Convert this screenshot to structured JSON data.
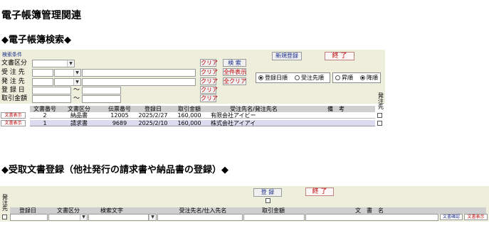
{
  "page_title": "電子帳簿管理関連",
  "search_section": {
    "heading": "◆電子帳簿検索◆",
    "conditions_label": "検索条件",
    "fields": {
      "doc_type_label": "文書区分",
      "recipient_label": "受 注 先",
      "sender_label": "発 注 先",
      "register_date_label": "登 録 日",
      "amount_label": "取引金額",
      "range_sep": "～"
    },
    "clear_label": "クリア",
    "search_button": "検 索",
    "show_all_button": "全件表示",
    "clear_all_button": "全クリア",
    "new_register_button": "新規登録",
    "end_button": "終 了",
    "sort_key_options": [
      "登録日順",
      "受注先順"
    ],
    "sort_key_selected": "登録日順",
    "sort_order_options": [
      "昇順",
      "降順"
    ],
    "sort_order_selected": "降順",
    "issued_col_label": "発注先",
    "table": {
      "columns": [
        "文書番号",
        "文書区分",
        "伝票番号",
        "登録日",
        "取引金額",
        "受注先名/発注先名",
        "備　考"
      ],
      "row_button": "文書表示",
      "rows": [
        {
          "doc_no": "2",
          "doc_type": "納品書",
          "slip_no": "12005",
          "date": "2025/2/27",
          "amount": "160,000",
          "partner": "有限会社アイビー",
          "note": ""
        },
        {
          "doc_no": "1",
          "doc_type": "請求書",
          "slip_no": "9689",
          "date": "2025/2/10",
          "amount": "160,000",
          "partner": "株式会社アイアイ",
          "note": ""
        }
      ]
    }
  },
  "register_section": {
    "heading": "◆受取文書登録（他社発行の請求書や納品書の登録）◆",
    "register_button": "登 録",
    "end_button": "終 了",
    "issued_col_label": "発注先",
    "columns": [
      "登録日",
      "文書区分",
      "検索文字",
      "受注先名/仕入先名",
      "取引金額",
      "文　書　名"
    ],
    "confirm_button": "文書確認",
    "display_button": "文書表示"
  },
  "colors": {
    "panel_bg": "#eeeedd",
    "header_bg": "#cfcfcf",
    "selected_row_bg": "#dcdcf0",
    "button_red": "#c00000",
    "button_blue": "#1b2d8a"
  }
}
